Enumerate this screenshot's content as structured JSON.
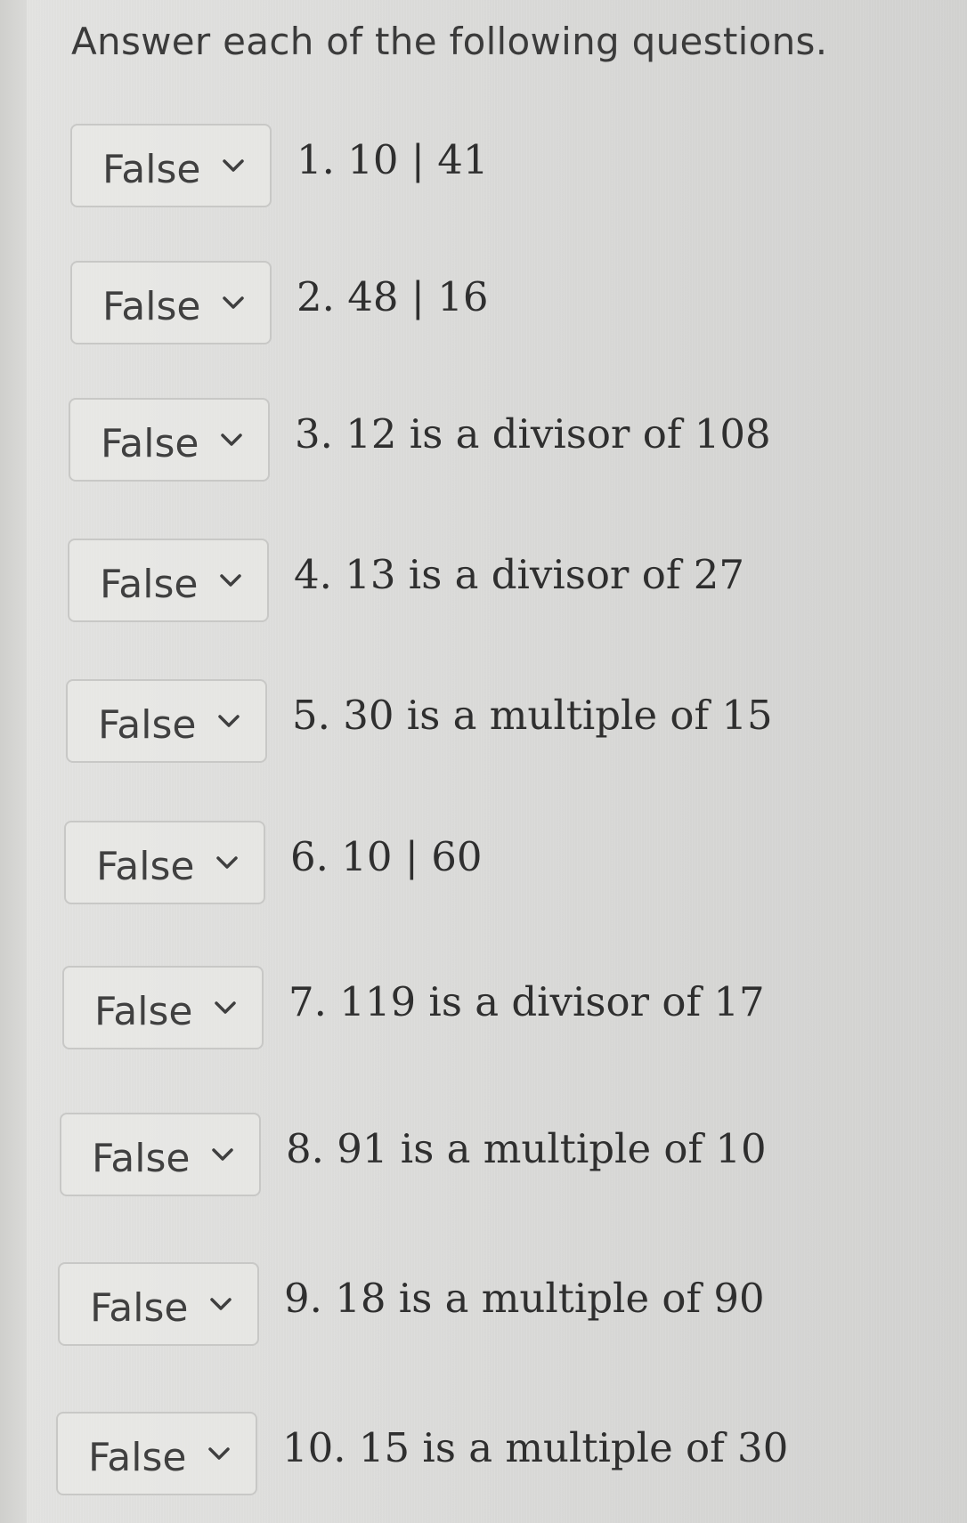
{
  "instructions": "Answer each of the following questions.",
  "questions": [
    {
      "answer": "False",
      "text": "1. 10 | 41"
    },
    {
      "answer": "False",
      "text": "2. 48 | 16"
    },
    {
      "answer": "False",
      "text": "3. 12 is a divisor of 108"
    },
    {
      "answer": "False",
      "text": "4. 13 is a divisor of 27"
    },
    {
      "answer": "False",
      "text": "5. 30 is a multiple of 15"
    },
    {
      "answer": "False",
      "text": "6. 10 | 60"
    },
    {
      "answer": "False",
      "text": "7. 119 is a divisor of 17"
    },
    {
      "answer": "False",
      "text": "8. 91 is a multiple of 10"
    },
    {
      "answer": "False",
      "text": "9. 18 is a multiple of 90"
    },
    {
      "answer": "False",
      "text": "10. 15 is a multiple of 30"
    }
  ],
  "icons": {
    "dropdown": "chevron-down-icon"
  }
}
